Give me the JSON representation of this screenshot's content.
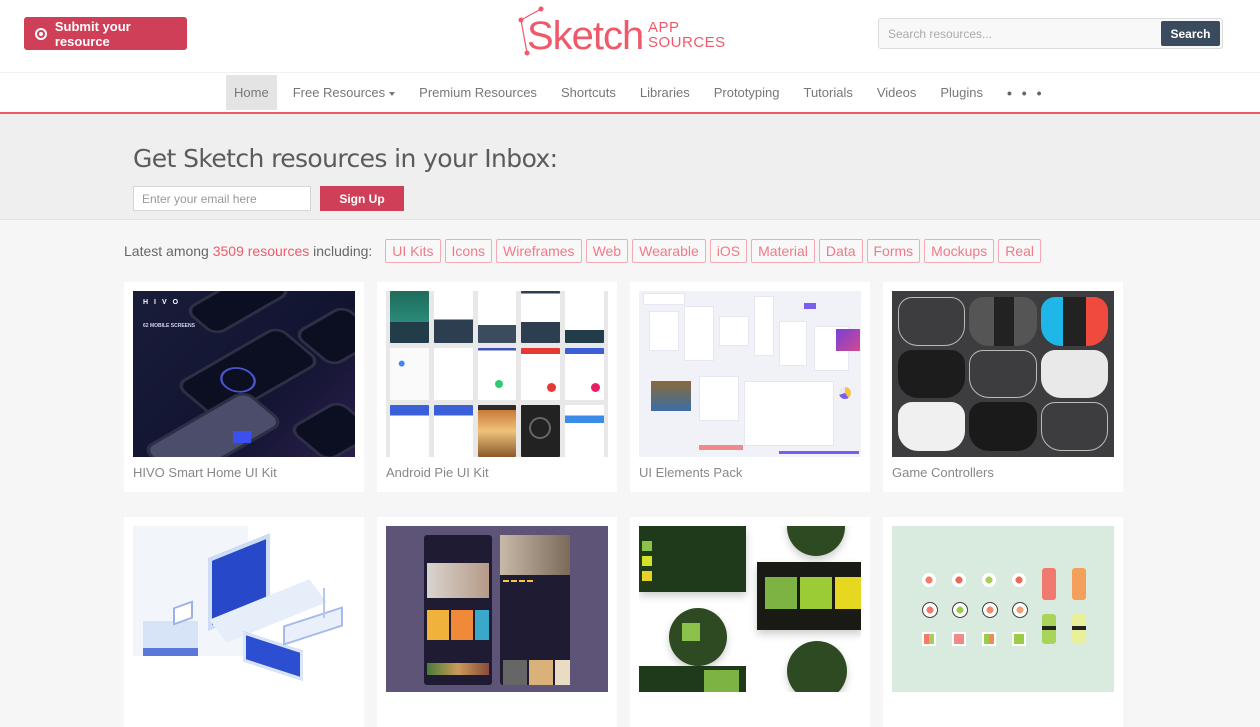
{
  "header": {
    "submit_label": "Submit your resource",
    "logo": {
      "main": "Sketch",
      "app": "APP",
      "sources": "SOURCES"
    },
    "search": {
      "placeholder": "Search resources...",
      "value": "",
      "button_label": "Search"
    },
    "brand_color": "#f0596a",
    "button_color": "#cf3f58",
    "search_button_color": "#3b4b5e"
  },
  "nav": {
    "items": [
      {
        "label": "Home",
        "active": true
      },
      {
        "label": "Free Resources",
        "dropdown": true
      },
      {
        "label": "Premium Resources"
      },
      {
        "label": "Shortcuts"
      },
      {
        "label": "Libraries"
      },
      {
        "label": "Prototyping"
      },
      {
        "label": "Tutorials"
      },
      {
        "label": "Videos"
      },
      {
        "label": "Plugins"
      }
    ],
    "more_label": "• • •"
  },
  "newsletter": {
    "heading": "Get Sketch resources in your Inbox:",
    "email_placeholder": "Enter your email here",
    "email_value": "",
    "signup_label": "Sign Up"
  },
  "tags": {
    "prefix": "Latest among",
    "count": "3509 resources",
    "suffix": "including:",
    "items": [
      "UI Kits",
      "Icons",
      "Wireframes",
      "Web",
      "Wearable",
      "iOS",
      "Material",
      "Data",
      "Forms",
      "Mockups",
      "Real"
    ]
  },
  "cards": [
    {
      "title": "HIVO Smart Home UI Kit",
      "thumb": "hivo-smart-home-preview"
    },
    {
      "title": "Android Pie UI Kit",
      "thumb": "android-pie-screens-preview"
    },
    {
      "title": "UI Elements Pack",
      "thumb": "ui-elements-preview"
    },
    {
      "title": "Game Controllers",
      "thumb": "game-controllers-preview"
    },
    {
      "title": "",
      "thumb": "isometric-devices-illustration"
    },
    {
      "title": "",
      "thumb": "movie-app-ui-preview"
    },
    {
      "title": "",
      "thumb": "wear-os-ui-preview"
    },
    {
      "title": "",
      "thumb": "sushi-icons-preview"
    }
  ]
}
